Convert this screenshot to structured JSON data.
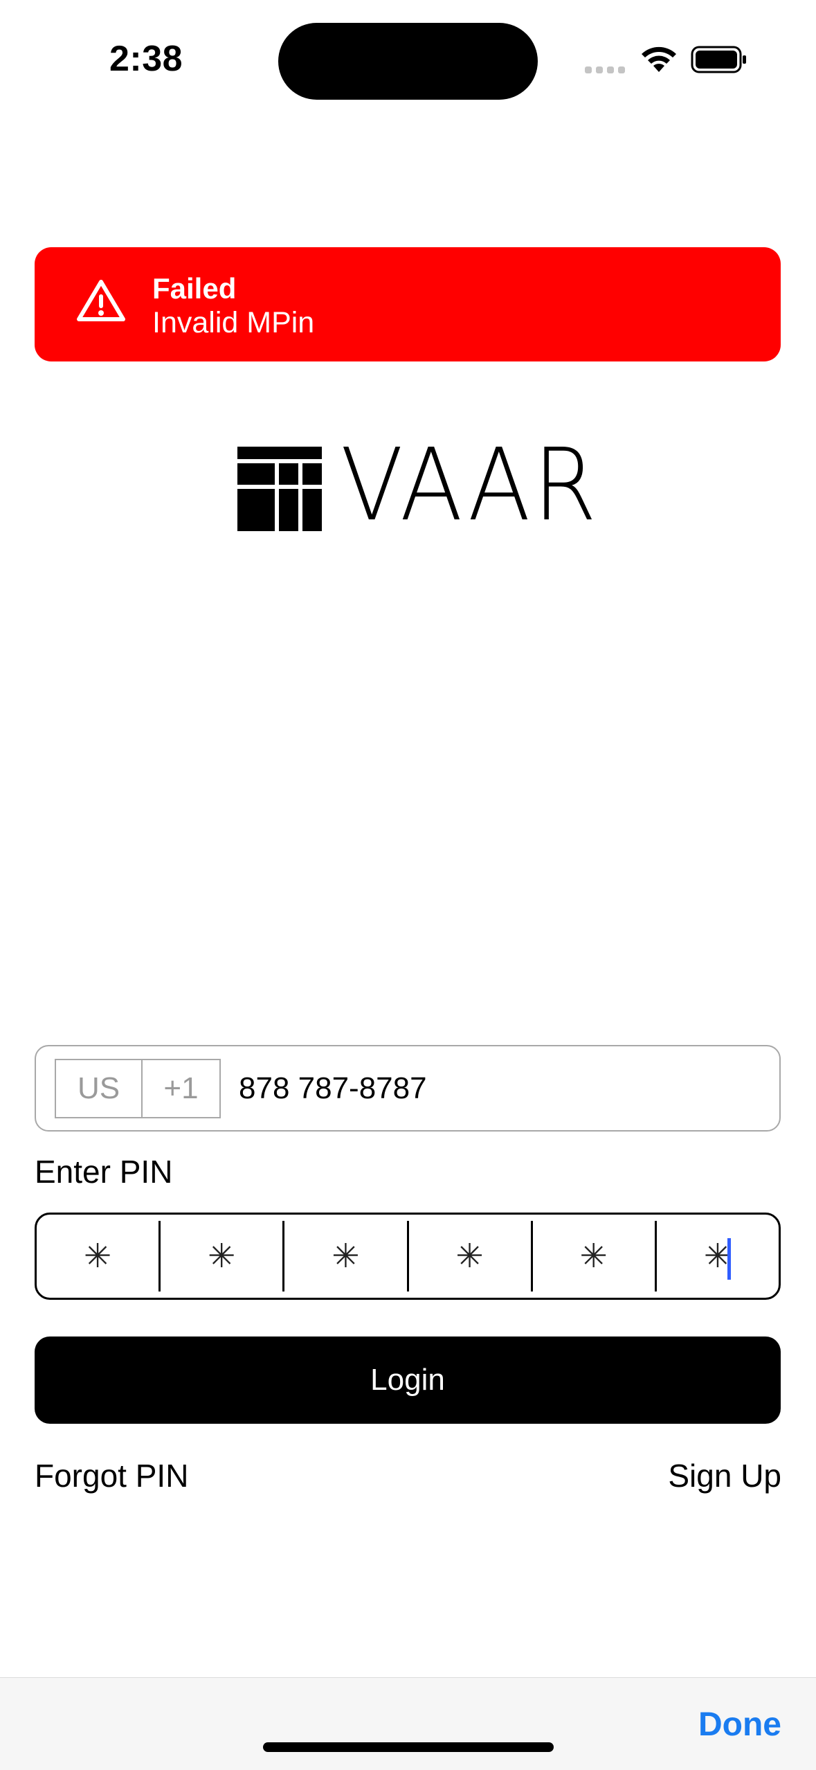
{
  "status_bar": {
    "time": "2:38",
    "icons": [
      "cellular-signal-icon",
      "wifi-icon",
      "battery-icon"
    ]
  },
  "banner": {
    "title": "Failed",
    "message": "Invalid MPin",
    "icon": "warning-triangle-icon",
    "color": "#ff0000"
  },
  "logo": {
    "text": "VAAR"
  },
  "phone": {
    "country": "US",
    "dial_code": "+1",
    "number": "878 787-8787"
  },
  "pin": {
    "label": "Enter PIN",
    "digits": [
      "✳",
      "✳",
      "✳",
      "✳",
      "✳",
      "✳"
    ]
  },
  "login_label": "Login",
  "forgot_label": "Forgot PIN",
  "signup_label": "Sign Up",
  "keyboard_accessory": {
    "done_label": "Done",
    "done_color": "#1a7cf0"
  }
}
